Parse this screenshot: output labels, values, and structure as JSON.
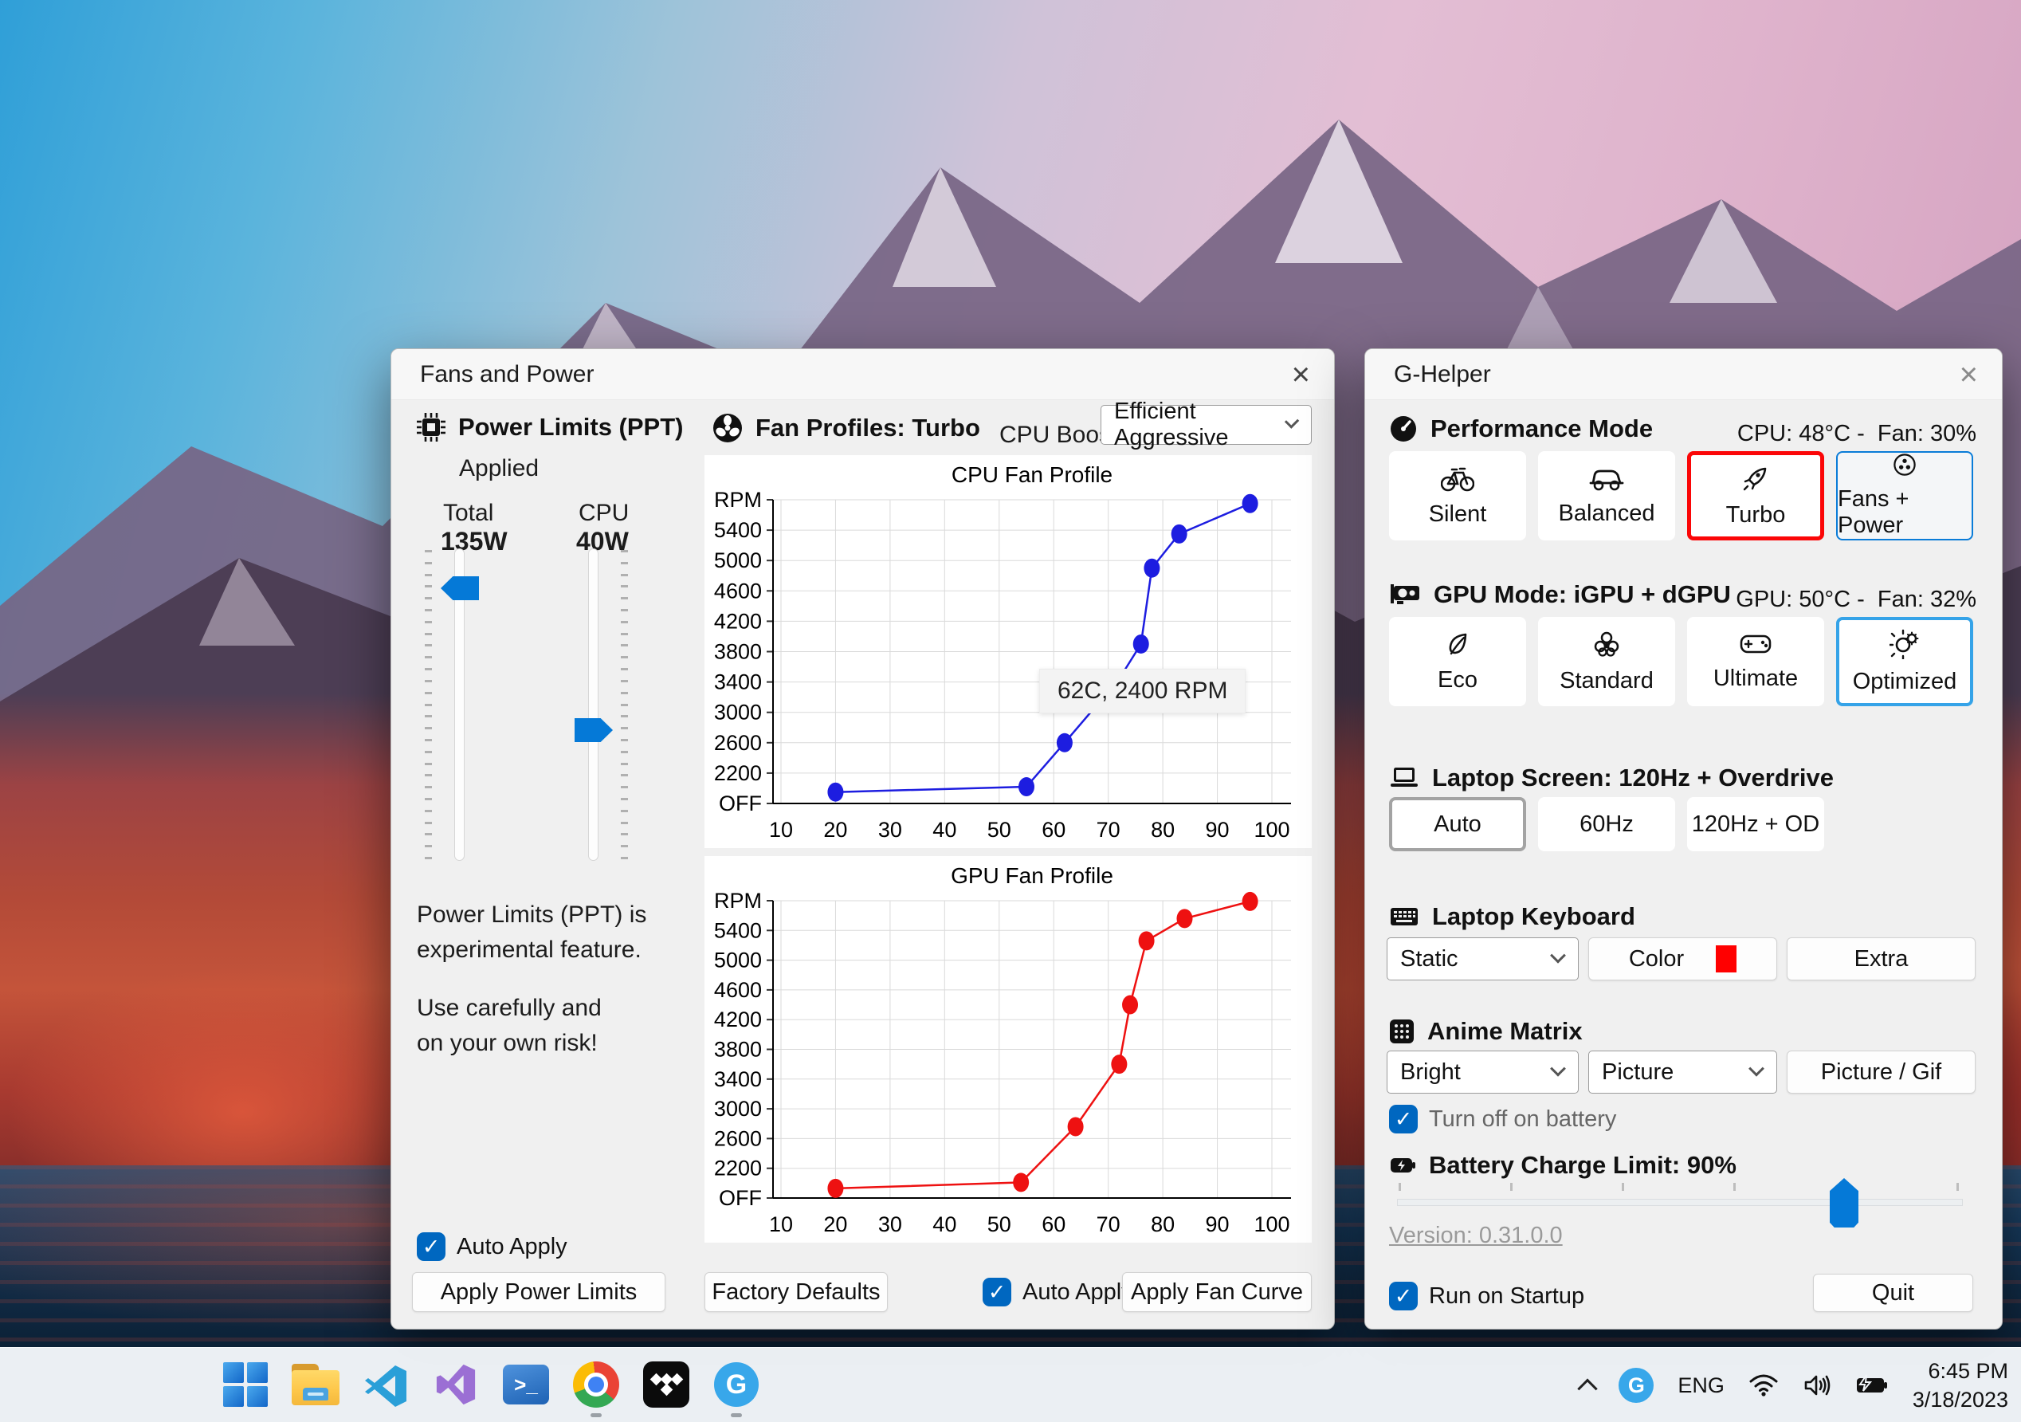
{
  "colors": {
    "accent_blue": "#0067c0",
    "selection_red": "#fb0607",
    "selection_light_blue": "#35a3e8",
    "chart_cpu": "#1d1de0",
    "chart_gpu": "#ee1111",
    "keyboard_swatch": "#ff0000"
  },
  "fans_window": {
    "title": "Fans and Power",
    "close": "×",
    "power": {
      "header": "Power Limits (PPT)",
      "applied": "Applied",
      "total_label": "Total",
      "total_value": "135W",
      "cpu_label": "CPU",
      "cpu_value": "40W",
      "note_line1": "Power Limits (PPT) is",
      "note_line2": "experimental feature.",
      "note_line3": "Use carefully and",
      "note_line4": "on your own risk!",
      "auto_apply": "Auto Apply",
      "check": "✓",
      "apply_button": "Apply Power Limits"
    },
    "fans": {
      "header": "Fan Profiles: Turbo",
      "cpu_boost_label": "CPU Boost",
      "cpu_boost_value": "Efficient Aggressive",
      "tooltip": "62C, 2400 RPM",
      "factory_defaults": "Factory Defaults",
      "auto_apply": "Auto Apply",
      "check": "✓",
      "apply_fan_curve": "Apply Fan Curve"
    }
  },
  "chart_data": [
    {
      "type": "line",
      "title": "CPU Fan Profile",
      "ylabel": "RPM",
      "xlabel": "",
      "x_ticks": [
        10,
        20,
        30,
        40,
        50,
        60,
        70,
        80,
        90,
        100
      ],
      "y_ticks": [
        "OFF",
        "2200",
        "2600",
        "3000",
        "3400",
        "3800",
        "4200",
        "4600",
        "5000",
        "5400",
        "RPM"
      ],
      "y_tick_values": [
        1800,
        2200,
        2600,
        3000,
        3400,
        3800,
        4200,
        4600,
        5000,
        5400,
        5800
      ],
      "ylim": [
        1800,
        5800
      ],
      "grid": true,
      "legend": "none",
      "annotation": "62C, 2400 RPM",
      "series": [
        {
          "name": "CPU fan curve",
          "color": "#1d1de0",
          "points": [
            [
              20,
              1950
            ],
            [
              55,
              2020
            ],
            [
              62,
              2600
            ],
            [
              72,
              3440
            ],
            [
              76,
              3900
            ],
            [
              78,
              4900
            ],
            [
              83,
              5350
            ],
            [
              96,
              5750
            ]
          ]
        }
      ]
    },
    {
      "type": "line",
      "title": "GPU Fan Profile",
      "ylabel": "RPM",
      "xlabel": "",
      "x_ticks": [
        10,
        20,
        30,
        40,
        50,
        60,
        70,
        80,
        90,
        100
      ],
      "y_ticks": [
        "OFF",
        "2200",
        "2600",
        "3000",
        "3400",
        "3800",
        "4200",
        "4600",
        "5000",
        "5400",
        "RPM"
      ],
      "y_tick_values": [
        1800,
        2200,
        2600,
        3000,
        3400,
        3800,
        4200,
        4600,
        5000,
        5400,
        5800
      ],
      "ylim": [
        1800,
        5800
      ],
      "grid": true,
      "legend": "none",
      "series": [
        {
          "name": "GPU fan curve",
          "color": "#ee1111",
          "points": [
            [
              20,
              1930
            ],
            [
              54,
              2010
            ],
            [
              64,
              2760
            ],
            [
              72,
              3600
            ],
            [
              74,
              4400
            ],
            [
              77,
              5260
            ],
            [
              84,
              5560
            ],
            [
              96,
              5790
            ]
          ]
        }
      ]
    }
  ],
  "ghelper": {
    "title": "G-Helper",
    "close": "×",
    "performance": {
      "header": "Performance Mode",
      "status": "CPU: 48°C -  Fan: 30%",
      "modes": [
        {
          "label": "Silent"
        },
        {
          "label": "Balanced"
        },
        {
          "label": "Turbo"
        },
        {
          "label": "Fans + Power"
        }
      ]
    },
    "gpu": {
      "header": "GPU Mode: iGPU + dGPU",
      "status": "GPU: 50°C -  Fan: 32%",
      "modes": [
        {
          "label": "Eco"
        },
        {
          "label": "Standard"
        },
        {
          "label": "Ultimate"
        },
        {
          "label": "Optimized"
        }
      ]
    },
    "screen": {
      "header": "Laptop Screen: 120Hz + Overdrive",
      "modes": [
        {
          "label": "Auto"
        },
        {
          "label": "60Hz"
        },
        {
          "label": "120Hz + OD"
        }
      ]
    },
    "keyboard": {
      "header": "Laptop Keyboard",
      "mode_value": "Static",
      "color_label": "Color",
      "extra_label": "Extra"
    },
    "matrix": {
      "header": "Anime Matrix",
      "brightness_value": "Bright",
      "running_value": "Picture",
      "picture_button": "Picture / Gif",
      "battery_checkbox": "Turn off on battery",
      "check": "✓"
    },
    "battery": {
      "header": "Battery Charge Limit: 90%",
      "percent": 90
    },
    "version": "Version: 0.31.0.0",
    "startup_checkbox": "Run on Startup",
    "startup_check": "✓",
    "quit": "Quit"
  },
  "taskbar": {
    "apps": [
      "start",
      "file-explorer",
      "vscode",
      "visual-studio",
      "powershell",
      "chrome",
      "tidal",
      "g-helper"
    ],
    "powershell_glyph": ">_",
    "ghelper_glyph": "G",
    "language": "ENG",
    "time": "6:45 PM",
    "date": "3/18/2023"
  }
}
